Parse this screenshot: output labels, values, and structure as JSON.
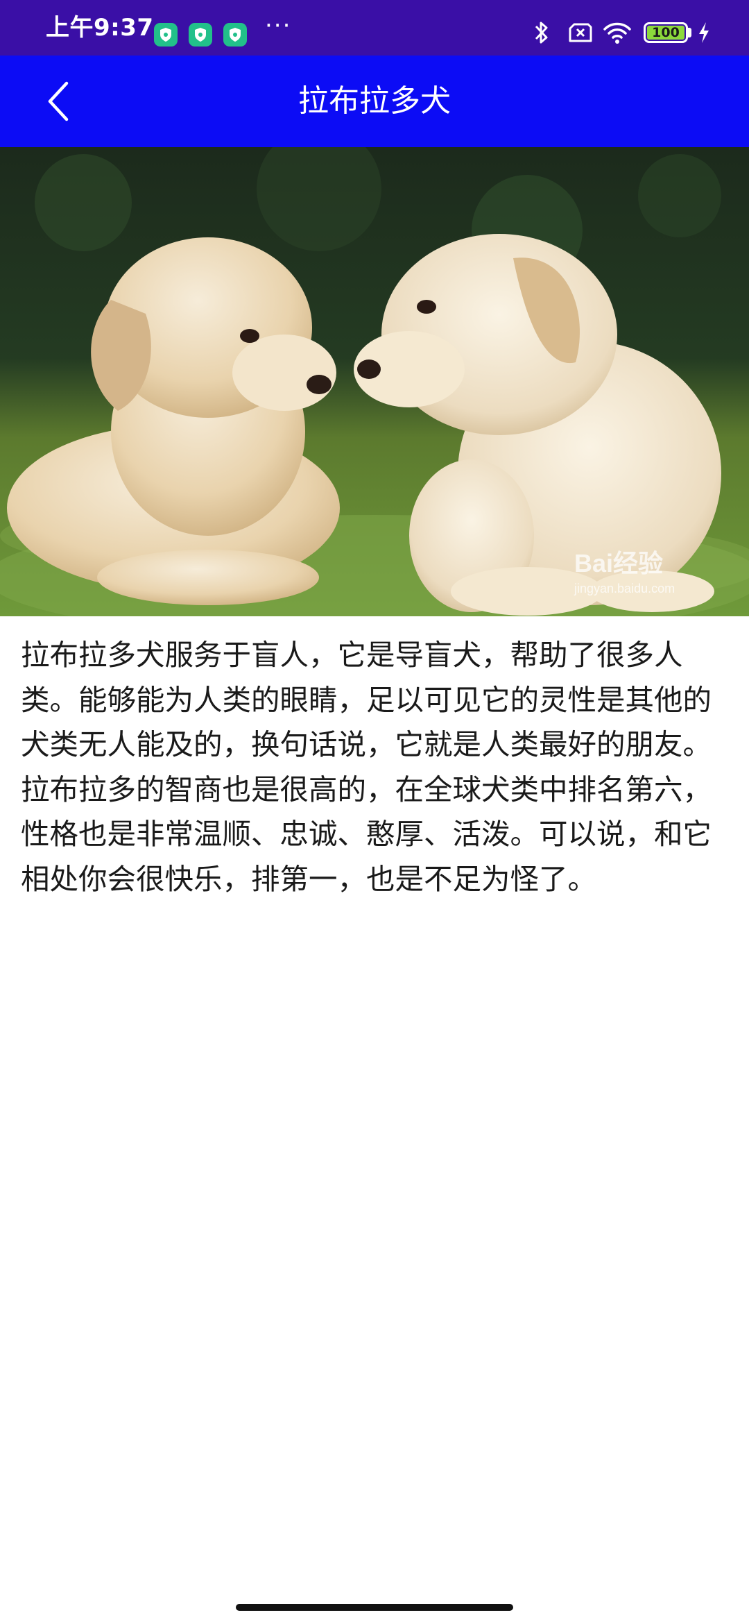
{
  "status_bar": {
    "time": "上午9:37",
    "overflow": "···",
    "battery_level": "100",
    "icons": [
      "shield-app-icon",
      "shield-app-icon",
      "shield-app-icon",
      "bluetooth-icon",
      "no-sim-icon",
      "wifi-icon",
      "battery-icon",
      "charging-icon"
    ]
  },
  "app_bar": {
    "title": "拉布拉多犬",
    "back_icon": "chevron-left-icon",
    "color": "#0c0cf5"
  },
  "image": {
    "subject": "two labrador puppies on grass",
    "watermark_brand": "Bai经验",
    "watermark_url": "jingyan.baidu.com"
  },
  "content": {
    "description": "拉布拉多犬服务于盲人，它是导盲犬，帮助了很多人类。能够能为人类的眼睛，足以可见它的灵性是其他的犬类无人能及的，换句话说，它就是人类最好的朋友。拉布拉多的智商也是很高的，在全球犬类中排名第六，性格也是非常温顺、忠诚、憨厚、活泼。可以说，和它相处你会很快乐，排第一，也是不足为怪了。"
  },
  "colors": {
    "status_bar": "#3a0fa6",
    "app_bar": "#0c0cf5",
    "app_icon_green": "#22c08a",
    "battery_fill": "#8cd93c"
  }
}
